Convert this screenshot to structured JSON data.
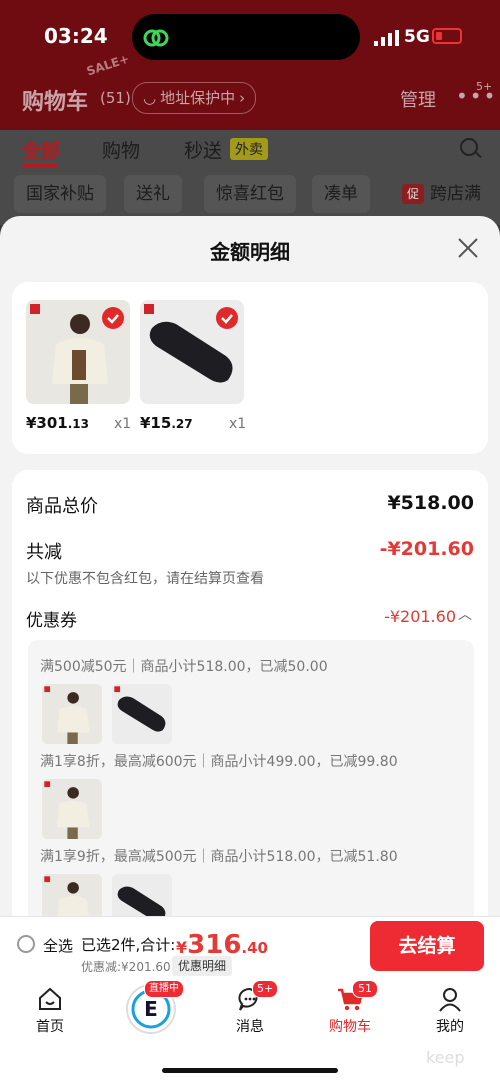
{
  "status": {
    "time": "03:24",
    "network": "5G"
  },
  "cart_header": {
    "title": "购物车",
    "count": "(51)",
    "address_protect": "地址保护中",
    "manage": "管理",
    "more_badge": "5+",
    "sale_stamp": "SALE+"
  },
  "tabs": [
    {
      "label": "全部"
    },
    {
      "label": "购物"
    },
    {
      "label": "秒送"
    }
  ],
  "waimai_tag": "外卖",
  "chips": [
    "国家补贴",
    "送礼",
    "惊喜红包",
    "凑单",
    "跨店满减"
  ],
  "chip_icon_text": "促",
  "sheet": {
    "title": "金额明细",
    "products": [
      {
        "price_main": "¥301",
        "price_dec": ".13",
        "qty": "x1"
      },
      {
        "price_main": "¥15",
        "price_dec": ".27",
        "qty": "x1"
      }
    ],
    "summary": {
      "total_label": "商品总价",
      "total_value": "¥518.00",
      "discount_label": "共减",
      "discount_value": "-¥201.60",
      "note": "以下优惠不包含红包，请在结算页查看",
      "coupon_label": "优惠券",
      "coupon_value": "-¥201.60"
    },
    "coupons": [
      "满500减50元｜商品小计518.00，已减50.00",
      "满1享8折，最高减600元｜商品小计499.00，已减99.80",
      "满1享9折，最高减500元｜商品小计518.00，已减51.80"
    ]
  },
  "bottom": {
    "select_all": "全选",
    "selected_text": "已选2件,合计:",
    "currency": "¥",
    "total_main": "316",
    "total_dec": ".40",
    "discount_note": "优惠减:¥201.60",
    "detail_pill": "优惠明细",
    "checkout": "去结算"
  },
  "tabbar": [
    {
      "label": "首页"
    },
    {
      "label": "",
      "badge": "直播中"
    },
    {
      "label": "消息",
      "badge": "5+"
    },
    {
      "label": "购物车",
      "badge": "51"
    },
    {
      "label": "我的"
    }
  ],
  "watermark": "keep",
  "colors": {
    "accent": "#ee2a33",
    "discount": "#e53935"
  }
}
